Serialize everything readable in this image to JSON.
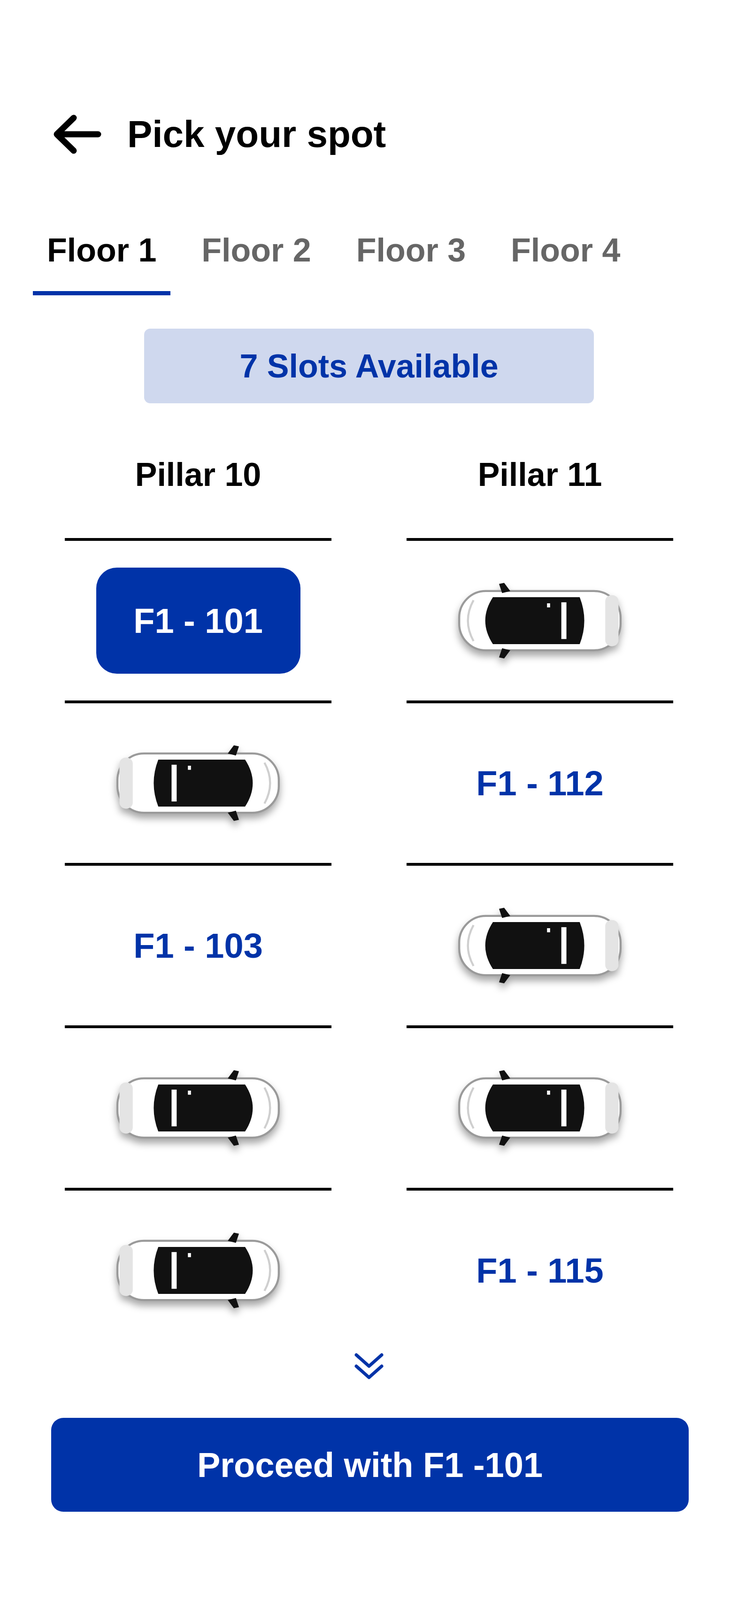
{
  "header": {
    "title": "Pick your spot"
  },
  "tabs": [
    {
      "label": "Floor 1",
      "selected": true
    },
    {
      "label": "Floor 2",
      "selected": false
    },
    {
      "label": "Floor 3",
      "selected": false
    },
    {
      "label": "Floor 4",
      "selected": false
    }
  ],
  "availability": "7 Slots Available",
  "pillars": [
    {
      "name": "Pillar 10",
      "slots": [
        {
          "kind": "free",
          "label": "F1 - 101",
          "selected": true
        },
        {
          "kind": "occupied",
          "selected": false
        },
        {
          "kind": "free",
          "label": "F1 - 103",
          "selected": false
        },
        {
          "kind": "occupied",
          "selected": false
        },
        {
          "kind": "occupied",
          "selected": false
        }
      ]
    },
    {
      "name": "Pillar 11",
      "slots": [
        {
          "kind": "occupied",
          "selected": false
        },
        {
          "kind": "free",
          "label": "F1 - 112",
          "selected": false
        },
        {
          "kind": "occupied",
          "selected": false
        },
        {
          "kind": "occupied",
          "selected": false
        },
        {
          "kind": "free",
          "label": "F1 - 115",
          "selected": false
        }
      ]
    }
  ],
  "proceed_button": "Proceed with F1 -101"
}
